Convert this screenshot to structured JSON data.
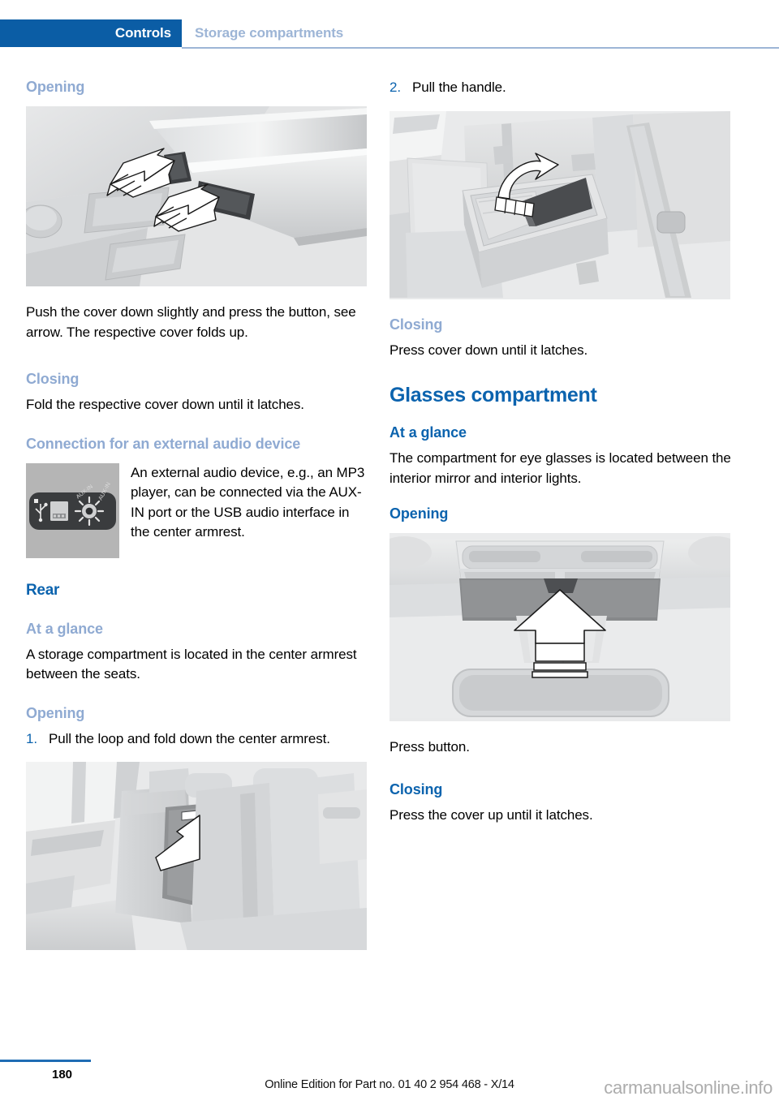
{
  "header": {
    "tab_label": "Controls",
    "section_label": "Storage compartments"
  },
  "left_column": {
    "opening_heading": "Opening",
    "figure1_caption": "center-console-cover-buttons-illustration",
    "opening_body": "Push the cover down slightly and press the button, see arrow. The respective cover folds up.",
    "closing_heading": "Closing",
    "closing_body": "Fold the respective cover down until it latches.",
    "connection_heading": "Connection for an external audio device",
    "aux_thumb_name": "aux-in-usb-port-illustration",
    "connection_body": "An external audio device, e.g., an MP3 player, can be connected via the AUX-IN port or the USB audio interface in the center armrest.",
    "rear_heading": "Rear",
    "rear_at_a_glance_heading": "At a glance",
    "rear_at_a_glance_body": "A storage compartment is located in the center armrest between the seats.",
    "rear_opening_heading": "Opening",
    "step1_number": "1.",
    "step1_text": "Pull the loop and fold down the center armrest.",
    "figure2_caption": "rear-seat-center-armrest-illustration"
  },
  "right_column": {
    "step2_number": "2.",
    "step2_text": "Pull the handle.",
    "figure3_caption": "rear-armrest-storage-open-illustration",
    "closing_heading": "Closing",
    "closing_body": "Press cover down until it latches.",
    "glasses_heading": "Glasses compartment",
    "glasses_at_a_glance_heading": "At a glance",
    "glasses_at_a_glance_body": "The compartment for eye glasses is located between the interior mirror and interior lights.",
    "glasses_opening_heading": "Opening",
    "figure4_caption": "overhead-glasses-compartment-illustration",
    "glasses_opening_body": "Press button.",
    "glasses_closing_heading": "Closing",
    "glasses_closing_body": "Press the cover up until it latches."
  },
  "footer": {
    "page_number": "180",
    "edition_text": "Online Edition for Part no. 01 40 2 954 468 - X/14",
    "watermark": "carmanualsonline.info"
  },
  "colors": {
    "tab_blue": "#0B5DA5",
    "heading_blue": "#0B63AE",
    "subheading_light_blue": "#8FAAD2",
    "rule_blue": "#9DB5D6",
    "footer_rule": "#1F6CB4"
  }
}
